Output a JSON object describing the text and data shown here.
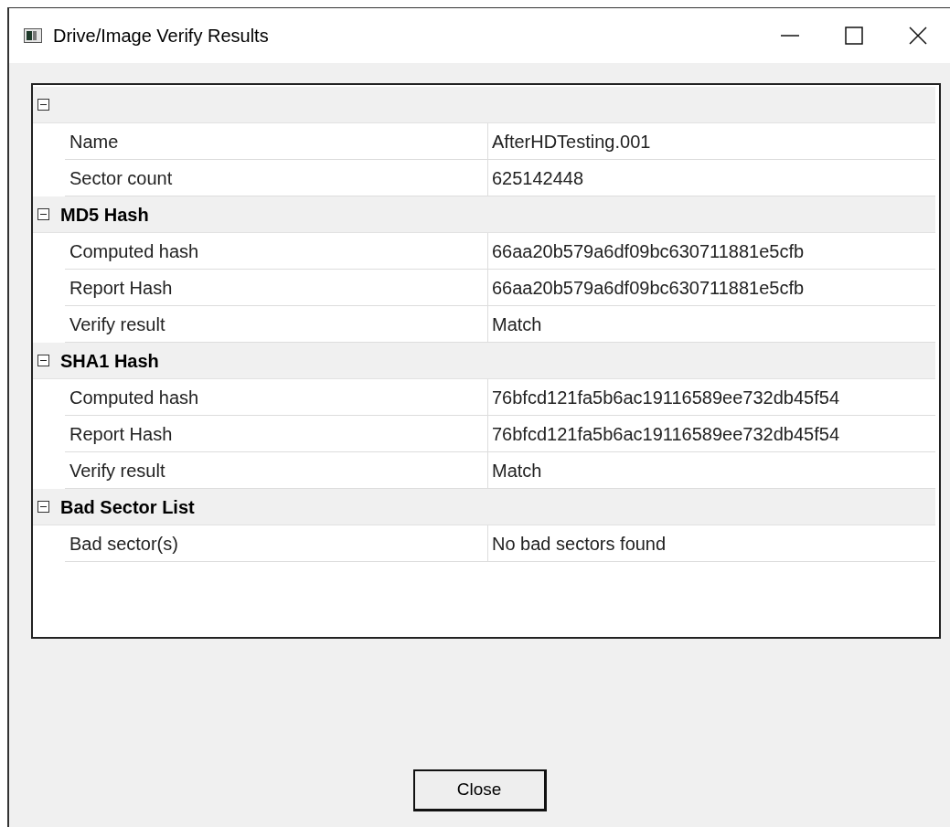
{
  "window": {
    "title": "Drive/Image Verify Results"
  },
  "groups": [
    {
      "expanded": true,
      "rows": [
        {
          "label": "Name",
          "value": "AfterHDTesting.001"
        },
        {
          "label": "Sector count",
          "value": "625142448"
        }
      ]
    },
    {
      "name": "MD5 Hash",
      "expanded": true,
      "rows": [
        {
          "label": "Computed hash",
          "value": "66aa20b579a6df09bc630711881e5cfb"
        },
        {
          "label": "Report Hash",
          "value": "66aa20b579a6df09bc630711881e5cfb"
        },
        {
          "label": "Verify result",
          "value": "Match"
        }
      ]
    },
    {
      "name": "SHA1 Hash",
      "expanded": true,
      "rows": [
        {
          "label": "Computed hash",
          "value": "76bfcd121fa5b6ac19116589ee732db45f54"
        },
        {
          "label": "Report Hash",
          "value": "76bfcd121fa5b6ac19116589ee732db45f54"
        },
        {
          "label": "Verify result",
          "value": "Match"
        }
      ]
    },
    {
      "name": "Bad Sector List",
      "expanded": true,
      "rows": [
        {
          "label": "Bad sector(s)",
          "value": "No bad sectors found"
        }
      ]
    }
  ],
  "buttons": [
    {
      "label": "Close"
    }
  ]
}
